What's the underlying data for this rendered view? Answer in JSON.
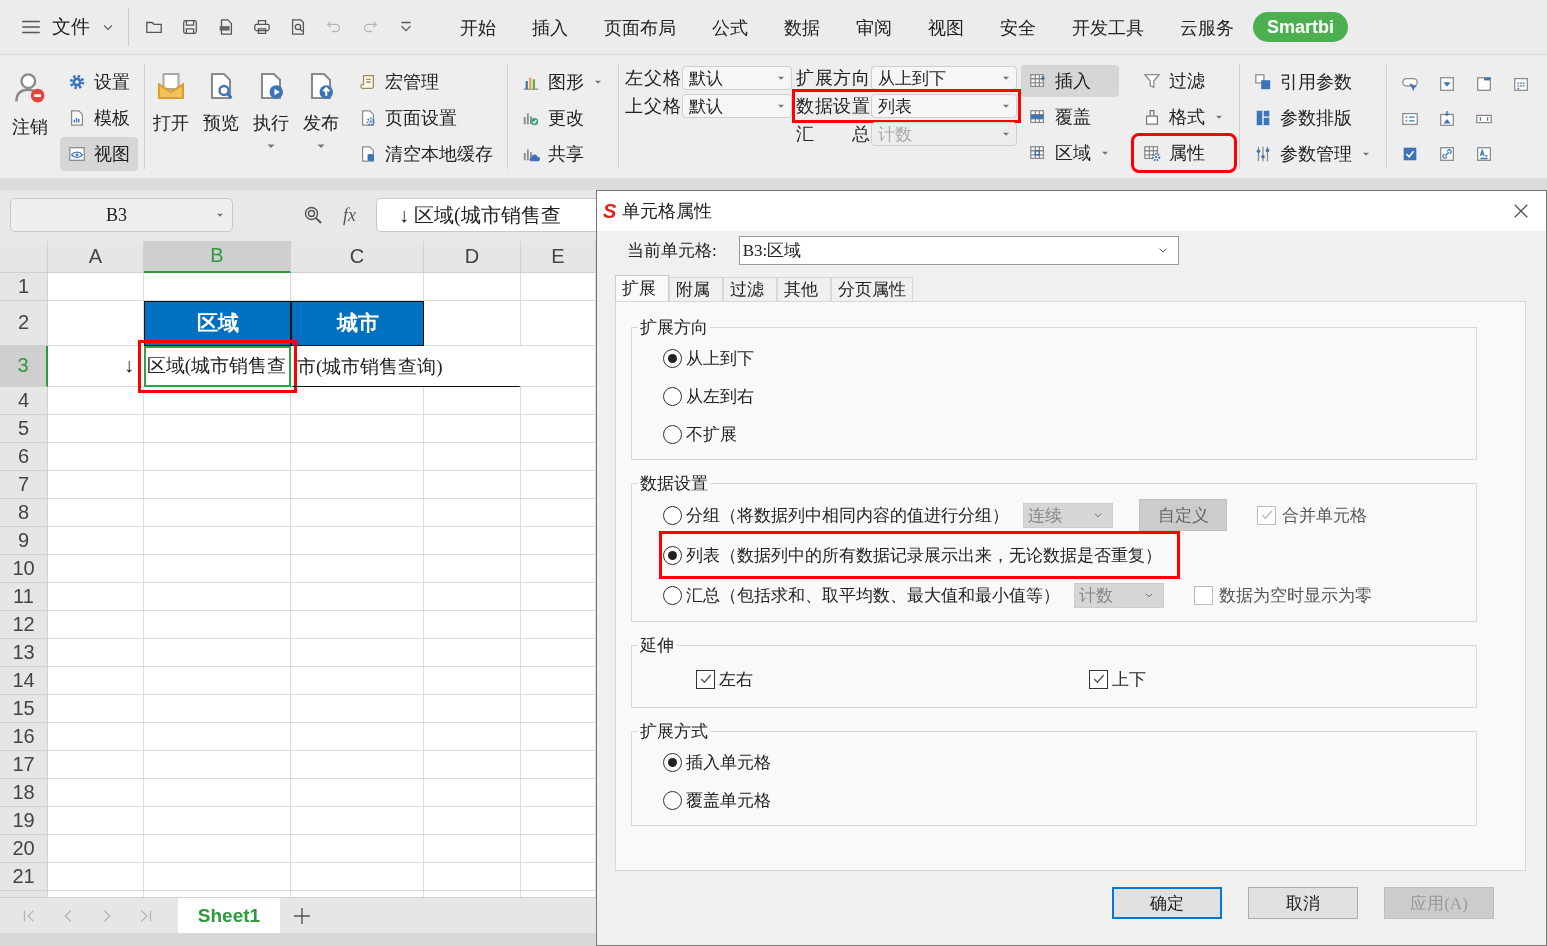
{
  "menu_bar": {
    "file_menu": "文件",
    "quick_access": [
      {
        "kind": "open",
        "disabled": false
      },
      {
        "kind": "save",
        "disabled": false
      },
      {
        "kind": "pdf",
        "disabled": false
      },
      {
        "kind": "print",
        "disabled": false
      },
      {
        "kind": "print-preview",
        "disabled": false
      },
      {
        "kind": "undo",
        "disabled": true
      },
      {
        "kind": "redo",
        "disabled": true
      },
      {
        "kind": "customize",
        "disabled": false
      }
    ],
    "tabs": [
      {
        "label": "开始",
        "selected": false
      },
      {
        "label": "插入",
        "selected": false
      },
      {
        "label": "页面布局",
        "selected": false
      },
      {
        "label": "公式",
        "selected": false
      },
      {
        "label": "数据",
        "selected": false
      },
      {
        "label": "审阅",
        "selected": false
      },
      {
        "label": "视图",
        "selected": false
      },
      {
        "label": "安全",
        "selected": false
      },
      {
        "label": "开发工具",
        "selected": false
      },
      {
        "label": "云服务",
        "selected": false
      },
      {
        "label": "Smartbi",
        "selected": true
      }
    ]
  },
  "ribbon": {
    "account": {
      "large": {
        "label": "注销",
        "kind": "logout"
      },
      "small": [
        {
          "label": "设置",
          "kind": "settings",
          "selected": false
        },
        {
          "label": "模板",
          "kind": "template",
          "selected": false
        },
        {
          "label": "视图",
          "kind": "view",
          "selected": true
        }
      ]
    },
    "report": {
      "large": [
        {
          "label": "打开",
          "kind": "open-report",
          "has_menu": false
        },
        {
          "label": "预览",
          "kind": "preview",
          "has_menu": false
        },
        {
          "label": "执行",
          "kind": "run",
          "has_menu": true
        },
        {
          "label": "发布",
          "kind": "publish",
          "has_menu": true
        }
      ],
      "small": [
        {
          "label": "宏管理",
          "kind": "macro"
        },
        {
          "label": "页面设置",
          "kind": "page-setup"
        },
        {
          "label": "清空本地缓存",
          "kind": "cache"
        }
      ]
    },
    "chart_tools": [
      {
        "label": "图形",
        "kind": "chart",
        "has_menu": true
      },
      {
        "label": "更改",
        "kind": "change",
        "has_menu": false
      },
      {
        "label": "共享",
        "kind": "share",
        "has_menu": false
      }
    ],
    "cell_fields": [
      {
        "label": "左父格",
        "value": "默认",
        "disabled": false,
        "highlighted": false
      },
      {
        "label": "上父格",
        "value": "默认",
        "disabled": false,
        "highlighted": false
      },
      {
        "label": "扩展方向",
        "value": "从上到下",
        "disabled": false,
        "highlighted": false
      },
      {
        "label": "数据设置",
        "value": "列表",
        "disabled": false,
        "highlighted": true
      },
      {
        "label": "汇 总",
        "value": "计数",
        "disabled": true,
        "highlighted": false
      }
    ],
    "cell_buttons": [
      {
        "label": "插入",
        "kind": "insert",
        "has_menu": false,
        "selected": true,
        "highlighted": false
      },
      {
        "label": "覆盖",
        "kind": "cover",
        "has_menu": false,
        "selected": false,
        "highlighted": false
      },
      {
        "label": "区域",
        "kind": "region",
        "has_menu": true,
        "selected": false,
        "highlighted": false
      },
      {
        "label": "过滤",
        "kind": "filter",
        "has_menu": false,
        "selected": false,
        "highlighted": false
      },
      {
        "label": "格式",
        "kind": "format",
        "has_menu": true,
        "selected": false,
        "highlighted": false
      },
      {
        "label": "属性",
        "kind": "property",
        "has_menu": false,
        "selected": false,
        "highlighted": true
      }
    ],
    "param_buttons": [
      {
        "label": "引用参数",
        "kind": "param-ref",
        "has_menu": false
      },
      {
        "label": "参数排版",
        "kind": "param-layout",
        "has_menu": false
      },
      {
        "label": "参数管理",
        "kind": "param-manage",
        "has_menu": true
      }
    ],
    "control_icons": [
      [
        {
          "kind": "c-button"
        },
        {
          "kind": "c-dropdown"
        },
        {
          "kind": "c-window"
        },
        {
          "kind": "c-calendar"
        }
      ],
      [
        {
          "kind": "c-list"
        },
        {
          "kind": "c-picture"
        },
        {
          "kind": "c-textfield"
        }
      ],
      [
        {
          "kind": "c-checkbox"
        },
        {
          "kind": "c-link"
        },
        {
          "kind": "c-label"
        }
      ]
    ]
  },
  "formula_bar": {
    "name_box": "B3",
    "function_label": "fx",
    "formula": "↓ 区域(城市销售查"
  },
  "sheet": {
    "columns": [
      {
        "label": "A",
        "selected": false
      },
      {
        "label": "B",
        "selected": true
      },
      {
        "label": "C",
        "selected": false
      },
      {
        "label": "D",
        "selected": false
      },
      {
        "label": "E",
        "selected": false
      }
    ],
    "rows": [
      {
        "label": "1",
        "selected": false
      },
      {
        "label": "2",
        "selected": false
      },
      {
        "label": "3",
        "selected": true
      },
      {
        "label": "4",
        "selected": false
      },
      {
        "label": "5",
        "selected": false
      },
      {
        "label": "6",
        "selected": false
      },
      {
        "label": "7",
        "selected": false
      },
      {
        "label": "8",
        "selected": false
      },
      {
        "label": "9",
        "selected": false
      },
      {
        "label": "10",
        "selected": false
      },
      {
        "label": "11",
        "selected": false
      },
      {
        "label": "12",
        "selected": false
      },
      {
        "label": "13",
        "selected": false
      },
      {
        "label": "14",
        "selected": false
      },
      {
        "label": "15",
        "selected": false
      },
      {
        "label": "16",
        "selected": false
      },
      {
        "label": "17",
        "selected": false
      },
      {
        "label": "18",
        "selected": false
      },
      {
        "label": "19",
        "selected": false
      },
      {
        "label": "20",
        "selected": false
      },
      {
        "label": "21",
        "selected": false
      }
    ],
    "header_cells": [
      "区域",
      "城市"
    ],
    "field_cells": [
      {
        "marker": "↓",
        "text": "区域(城市销售查",
        "selected": true,
        "highlighted": true
      },
      {
        "text": "市(城市销售查询)",
        "selected": false,
        "highlighted": false
      }
    ],
    "sheet_tabs": [
      {
        "label": "Sheet1",
        "selected": true
      }
    ]
  },
  "dialog": {
    "logo": "S",
    "title": "单元格属性",
    "current_cell": {
      "label": "当前单元格:",
      "value": "B3:区域"
    },
    "tabs": [
      {
        "label": "扩展",
        "selected": true
      },
      {
        "label": "附属",
        "selected": false
      },
      {
        "label": "过滤",
        "selected": false
      },
      {
        "label": "其他",
        "selected": false
      },
      {
        "label": "分页属性",
        "selected": false
      }
    ],
    "groups": [
      {
        "title": "扩展方向",
        "options": [
          {
            "kind": "radio",
            "label": "从上到下",
            "selected": true
          },
          {
            "kind": "radio",
            "label": "从左到右",
            "selected": false
          },
          {
            "kind": "radio",
            "label": "不扩展",
            "selected": false
          }
        ]
      },
      {
        "title": "数据设置",
        "options": [
          {
            "kind": "radio",
            "label": "分组（将数据列中相同内容的值进行分组）",
            "selected": false,
            "highlighted": false,
            "dropdown": {
              "value": "连续",
              "disabled": true
            },
            "button": {
              "label": "自定义",
              "disabled": true
            },
            "checkbox": {
              "label": "合并单元格",
              "checked": true,
              "disabled": true
            }
          },
          {
            "kind": "radio",
            "label": "列表（数据列中的所有数据记录展示出来，无论数据是否重复）",
            "selected": true,
            "highlighted": true
          },
          {
            "kind": "radio",
            "label": "汇总（包括求和、取平均数、最大值和最小值等）",
            "selected": false,
            "highlighted": false,
            "dropdown": {
              "value": "计数",
              "disabled": true
            },
            "checkbox": {
              "label": "数据为空时显示为零",
              "checked": false,
              "disabled": true
            }
          }
        ]
      },
      {
        "title": "延伸",
        "options": [
          {
            "kind": "checkbox",
            "label": "左右",
            "checked": true
          },
          {
            "kind": "checkbox",
            "label": "上下",
            "checked": true
          }
        ]
      },
      {
        "title": "扩展方式",
        "options": [
          {
            "kind": "radio",
            "label": "插入单元格",
            "selected": true
          },
          {
            "kind": "radio",
            "label": "覆盖单元格",
            "selected": false
          }
        ]
      }
    ],
    "buttons": [
      {
        "label": "确定",
        "kind": "default",
        "disabled": false
      },
      {
        "label": "取消",
        "kind": "normal",
        "disabled": false
      },
      {
        "label": "应用(A)",
        "kind": "normal",
        "disabled": true
      }
    ]
  }
}
